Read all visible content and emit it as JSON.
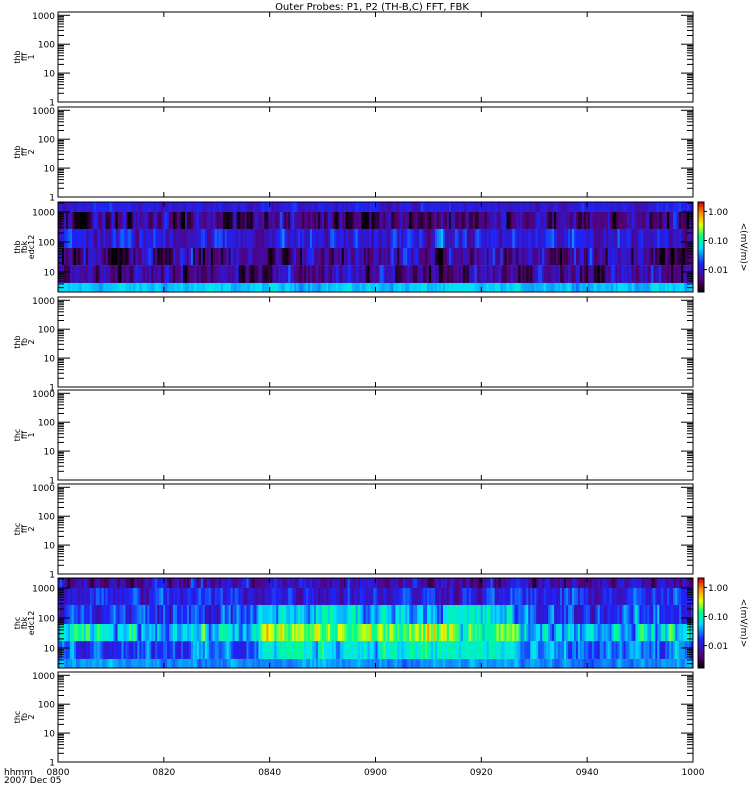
{
  "chart_data": {
    "type": "heatmap",
    "title": "Outer Probes: P1, P2 (TH-B,C) FFT, FBK",
    "xaxis": {
      "label_lines": [
        "hhmm",
        "2007 Dec 05"
      ],
      "range": [
        "0800",
        "1000"
      ],
      "tick_labels": [
        "0800",
        "0820",
        "0840",
        "0900",
        "0920",
        "0940",
        "1000"
      ],
      "scale": "time"
    },
    "panels": [
      {
        "label": [
          "thb",
          "fff",
          "1"
        ],
        "ylim": [
          1,
          1300
        ],
        "yscale": "log",
        "ytick_labels": [
          "1",
          "10",
          "100",
          "1000"
        ],
        "has_data": false
      },
      {
        "label": [
          "thb",
          "fff",
          "2"
        ],
        "ylim": [
          1,
          1300
        ],
        "yscale": "log",
        "ytick_labels": [
          "1",
          "10",
          "100",
          "1000"
        ],
        "has_data": false
      },
      {
        "label": [
          "thb",
          "fbk",
          "edc12"
        ],
        "ylim": [
          2.15,
          2150
        ],
        "yscale": "log",
        "ytick_labels": [
          "10",
          "100",
          "1000"
        ],
        "has_data": true,
        "freq_bin_edges_hz": [
          2.15,
          4.3,
          17,
          63,
          271,
          1000,
          2150
        ],
        "band_typical_mV_per_m": [
          0.05,
          0.006,
          0.005,
          0.012,
          0.005,
          0.012
        ],
        "band_variability_decades": [
          0.15,
          0.45,
          0.5,
          0.35,
          0.45,
          0.2
        ]
      },
      {
        "label": [
          "thb",
          "fb",
          "2"
        ],
        "ylim": [
          1,
          1300
        ],
        "yscale": "log",
        "ytick_labels": [
          "1",
          "10",
          "100",
          "1000"
        ],
        "has_data": false
      },
      {
        "label": [
          "thc",
          "fff",
          "1"
        ],
        "ylim": [
          1,
          1300
        ],
        "yscale": "log",
        "ytick_labels": [
          "1",
          "10",
          "100",
          "1000"
        ],
        "has_data": false
      },
      {
        "label": [
          "thc",
          "fff",
          "2"
        ],
        "ylim": [
          1,
          1300
        ],
        "yscale": "log",
        "ytick_labels": [
          "1",
          "10",
          "100",
          "1000"
        ],
        "has_data": false
      },
      {
        "label": [
          "thc",
          "fbk",
          "edc12"
        ],
        "ylim": [
          2.15,
          2150
        ],
        "yscale": "log",
        "ytick_labels": [
          "10",
          "100",
          "1000"
        ],
        "has_data": true,
        "freq_bin_edges_hz": [
          2.15,
          4.3,
          17,
          63,
          271,
          1000,
          2150
        ],
        "band_typical_mV_per_m": [
          0.035,
          0.025,
          0.06,
          0.018,
          0.014,
          0.008
        ],
        "band_variability_decades": [
          0.15,
          0.35,
          0.45,
          0.4,
          0.35,
          0.4
        ]
      },
      {
        "label": [
          "thc",
          "fb",
          "2"
        ],
        "ylim": [
          1,
          1300
        ],
        "yscale": "log",
        "ytick_labels": [
          "1",
          "10",
          "100",
          "1000"
        ],
        "has_data": false
      }
    ],
    "colorbar": {
      "label": "<(mV/m)>",
      "scale": "log",
      "range": [
        0.0017,
        2.1
      ],
      "tick_labels": [
        "0.01",
        "0.10",
        "1.00"
      ],
      "colormap": "rainbow (black-purple-blue-cyan-green-yellow-red)"
    }
  }
}
